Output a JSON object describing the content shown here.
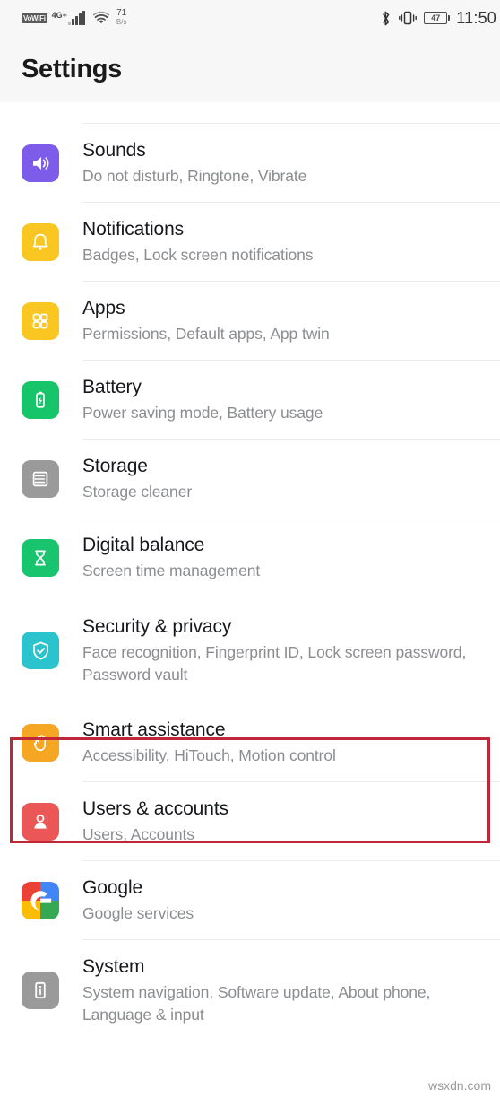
{
  "status_bar": {
    "vowifi_label": "VoWiFi",
    "network_label": "4G",
    "network_superscript": "+",
    "data_speed_value": "71",
    "data_speed_unit": "B/s",
    "bluetooth_icon": "bluetooth-icon",
    "vibrate_icon": "vibrate-icon",
    "battery_percent": "47",
    "time": "11:50"
  },
  "header": {
    "title": "Settings"
  },
  "list": {
    "clipped_top_row_hint": "",
    "items": [
      {
        "icon": "sound-icon",
        "icon_color": "#7C5CE8",
        "title": "Sounds",
        "subtitle": "Do not disturb, Ringtone, Vibrate"
      },
      {
        "icon": "bell-icon",
        "icon_color": "#F9C622",
        "title": "Notifications",
        "subtitle": "Badges, Lock screen notifications"
      },
      {
        "icon": "apps-grid-icon",
        "icon_color": "#F9C622",
        "title": "Apps",
        "subtitle": "Permissions, Default apps, App twin"
      },
      {
        "icon": "battery-icon",
        "icon_color": "#16C469",
        "title": "Battery",
        "subtitle": "Power saving mode, Battery usage"
      },
      {
        "icon": "storage-icon",
        "icon_color": "#9A9A9A",
        "title": "Storage",
        "subtitle": "Storage cleaner"
      },
      {
        "icon": "hourglass-icon",
        "icon_color": "#18C46D",
        "title": "Digital balance",
        "subtitle": "Screen time management"
      },
      {
        "icon": "shield-check-icon",
        "icon_color": "#2BC4CE",
        "title": "Security & privacy",
        "subtitle": "Face recognition, Fingerprint ID, Lock screen password, Password vault",
        "highlighted": true
      },
      {
        "icon": "hand-icon",
        "icon_color": "#F5A623",
        "title": "Smart assistance",
        "subtitle": "Accessibility, HiTouch, Motion control"
      },
      {
        "icon": "person-icon",
        "icon_color": "#EB5757",
        "title": "Users & accounts",
        "subtitle": "Users, Accounts"
      },
      {
        "icon": "google-icon",
        "icon_color": "#FFFFFF",
        "title": "Google",
        "subtitle": "Google services"
      },
      {
        "icon": "system-phone-info-icon",
        "icon_color": "#9A9A9A",
        "title": "System",
        "subtitle": "System navigation, Software update, About phone, Language & input"
      }
    ]
  },
  "highlight": {
    "color": "#C0283A",
    "target": "Security & privacy"
  },
  "watermark": {
    "text": "wsxdn.com"
  }
}
